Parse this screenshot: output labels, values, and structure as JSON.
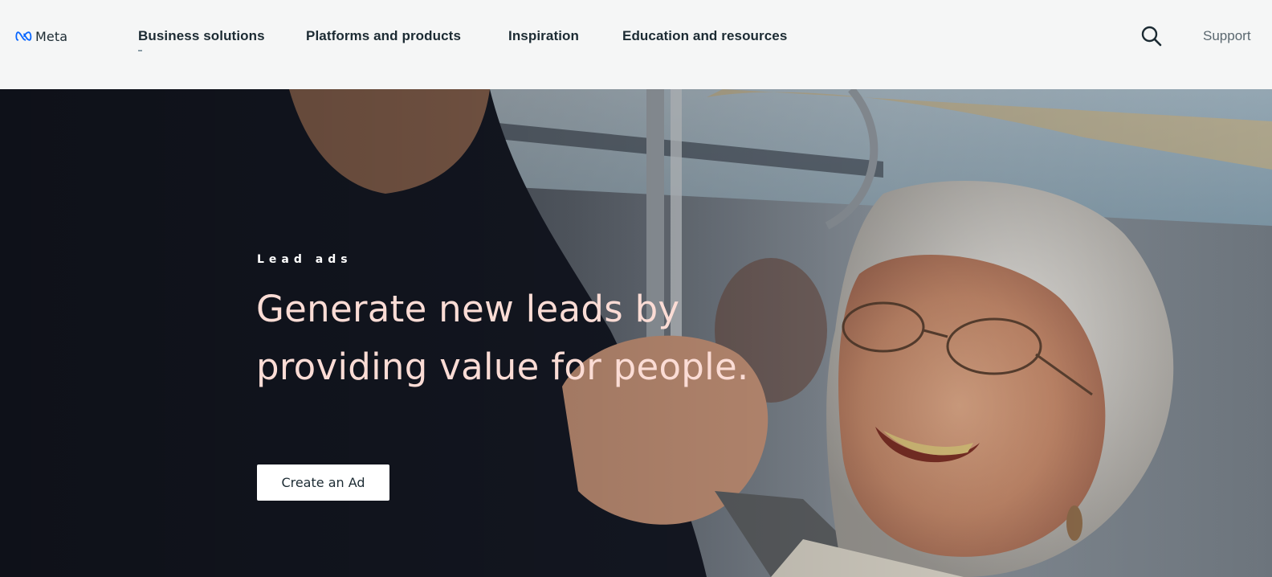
{
  "header": {
    "logo_text": "Meta",
    "nav": [
      {
        "label": "Business solutions"
      },
      {
        "label": "Platforms and products"
      },
      {
        "label": "Inspiration"
      },
      {
        "label": "Education and resources"
      }
    ],
    "search_icon": "search-icon",
    "support_label": "Support"
  },
  "hero": {
    "eyebrow": "Lead ads",
    "headline": "Generate new leads by providing value for people.",
    "cta_label": "Create an Ad"
  },
  "colors": {
    "header_bg": "#f5f6f6",
    "nav_text": "#1c2b33",
    "headline": "#fbdcd5",
    "cta_bg": "#ffffff",
    "meta_blue": "#0866ff"
  }
}
